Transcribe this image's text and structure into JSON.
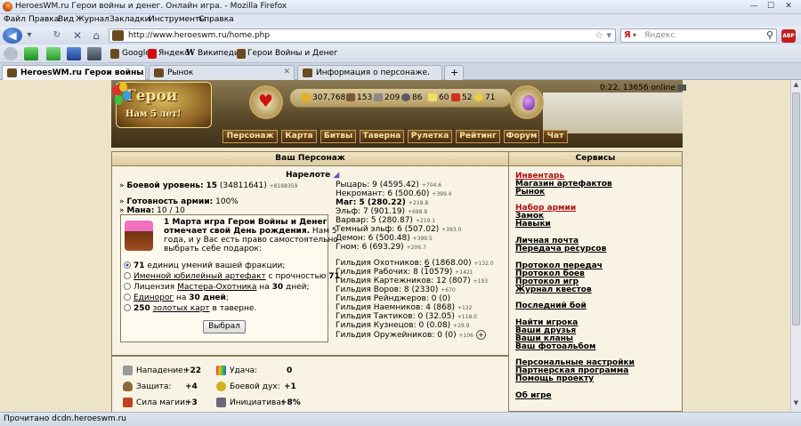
{
  "window": {
    "title": "HeroesWM.ru Герои войны и денег. Онлайн игра. - Mozilla Firefox",
    "min": "—",
    "max": "☐",
    "close": "✕"
  },
  "menu": [
    "Файл",
    "Правка",
    "Вид",
    "Журнал",
    "Закладки",
    "Инструменты",
    "Справка"
  ],
  "nav": {
    "url": "http://www.heroeswm.ru/home.php",
    "search_engine": "Я",
    "search_placeholder": "Яндекс",
    "abp": "ABP"
  },
  "bookmarks": [
    "Google",
    "Яндекс",
    "Википедия",
    "Герои Войны и Денег"
  ],
  "tabs": [
    {
      "label": "HeroesWM.ru Герои войны и де...",
      "active": true
    },
    {
      "label": "Рынок",
      "active": false
    },
    {
      "label": "Информация о персонаже.",
      "active": false
    }
  ],
  "header": {
    "logo_title": "Герои",
    "logo_sub": "Нам 5 лет!",
    "resources": [
      "307,768",
      "153",
      "209",
      "86",
      "60",
      "52",
      "71"
    ],
    "clock": "0:22, 13656 online",
    "nav_buttons": [
      "Персонаж",
      "Карта",
      "Битвы",
      "Таверна",
      "Рулетка",
      "Рейтинг",
      "Форум",
      "Чат"
    ]
  },
  "character": {
    "panel_title": "Ваш Персонаж",
    "name": "Нарелоте",
    "level_label": "Боевой уровень:",
    "level": "15",
    "level_exp": "(34811641)",
    "level_delta": "+8188359",
    "army_label": "Готовность армии:",
    "army_value": "100%",
    "mana_label": "Мана:",
    "mana_value": "10 / 10",
    "factions": [
      {
        "name": "Рыцарь:",
        "value": "9 (4595.42)",
        "delta": "+704.6",
        "bold": false
      },
      {
        "name": "Некромант:",
        "value": "6 (500.60)",
        "delta": "+399.4",
        "bold": false
      },
      {
        "name": "Маг:",
        "value": "5 (280.22)",
        "delta": "+219.8",
        "bold": true
      },
      {
        "name": "Эльф:",
        "value": "7 (901.19)",
        "delta": "+698.8",
        "bold": false
      },
      {
        "name": "Варвар:",
        "value": "5 (280.87)",
        "delta": "+219.1",
        "bold": false
      },
      {
        "name": "Темный эльф:",
        "value": "6 (507.02)",
        "delta": "+393.0",
        "bold": false
      },
      {
        "name": "Демон:",
        "value": "6 (500.48)",
        "delta": "+399.5",
        "bold": false
      },
      {
        "name": "Гном:",
        "value": "6 (693.29)",
        "delta": "+206.7",
        "bold": false
      }
    ],
    "guilds": [
      {
        "name": "Гильдия Охотников:",
        "value": "6",
        "extra": "(1868.00)",
        "delta": "+132.0"
      },
      {
        "name": "Гильдия Рабочих:",
        "value": "8",
        "extra": "(10579)",
        "delta": "+1421"
      },
      {
        "name": "Гильдия Картежников:",
        "value": "12",
        "extra": "(807)",
        "delta": "+193"
      },
      {
        "name": "Гильдия Воров:",
        "value": "8",
        "extra": "(2330)",
        "delta": "+670"
      },
      {
        "name": "Гильдия Рейнджеров:",
        "value": "0",
        "extra": "(0)",
        "delta": ""
      },
      {
        "name": "Гильдия Наемников:",
        "value": "4",
        "extra": "(868)",
        "delta": "+132"
      },
      {
        "name": "Гильдия Тактиков:",
        "value": "0",
        "extra": "(32.05)",
        "delta": "+118.0"
      },
      {
        "name": "Гильдия Кузнецов:",
        "value": "0",
        "extra": "(0.08)",
        "delta": "+29.9"
      },
      {
        "name": "Гильдия Оружейников:",
        "value": "0",
        "extra": "(0)",
        "delta": "+106"
      }
    ],
    "guild_plus": "+"
  },
  "birthday": {
    "line1": "1 Марта игра Герои Войны и Денег",
    "line2": "отмечает свой День рождения. Нам 5",
    "line3": "года, и у Вас есть право самостоятельно",
    "line4": "выбрать себе подарок:",
    "opt1_bold": "71",
    "opt1_rest": "единиц умений вашей фракции;",
    "opt2_link": "Именной юбилейный артефакт",
    "opt2_rest": "с прочностью",
    "opt2_val": "71",
    "opt3_pre": "Лицензия",
    "opt3_link": "Мастера-Охотника",
    "opt3_mid": "на",
    "opt3_val": "30",
    "opt3_post": "дней;",
    "opt4_link": "Единорог",
    "opt4_mid": "на",
    "opt4_val": "30 дней",
    "opt5_bold": "250",
    "opt5_link": "золотых карт",
    "opt5_post": "в таверне.",
    "button": "Выбрал"
  },
  "stats": [
    {
      "label": "Нападение:",
      "value": "+22"
    },
    {
      "label": "Удача:",
      "value": "0"
    },
    {
      "label": "Защита:",
      "value": "+4"
    },
    {
      "label": "Боевой дух:",
      "value": "+1"
    },
    {
      "label": "Сила магии:",
      "value": "+3"
    },
    {
      "label": "Инициатива:",
      "value": "+8%"
    }
  ],
  "services": {
    "title": "Сервисы",
    "links": [
      {
        "label": "Инвентарь",
        "red": true
      },
      {
        "label": "Магазин артефактов",
        "red": false
      },
      {
        "label": "Рынок",
        "red": false
      },
      {
        "label": "Набор армии",
        "red": true
      },
      {
        "label": "Замок",
        "red": false
      },
      {
        "label": "Навыки",
        "red": false
      },
      {
        "label": "Личная почта",
        "red": false
      },
      {
        "label": "Передача ресурсов",
        "red": false
      },
      {
        "label": "Протокол передач",
        "red": false
      },
      {
        "label": "Протокол боев",
        "red": false
      },
      {
        "label": "Протокол игр",
        "red": false
      },
      {
        "label": "Журнал квестов",
        "red": false
      },
      {
        "label": "Последний бой",
        "red": false
      },
      {
        "label": "Найти игрока",
        "red": false
      },
      {
        "label": "Ваши друзья",
        "red": false
      },
      {
        "label": "Ваши кланы",
        "red": false
      },
      {
        "label": "Ваш фотоальбом",
        "red": false
      },
      {
        "label": "Персональные настройки",
        "red": false
      },
      {
        "label": "Партнерская программа",
        "red": false
      },
      {
        "label": "Помощь проекту",
        "red": false
      },
      {
        "label": "Об игре",
        "red": false
      }
    ]
  },
  "status_text": "Прочитано dcdn.heroeswm.ru"
}
